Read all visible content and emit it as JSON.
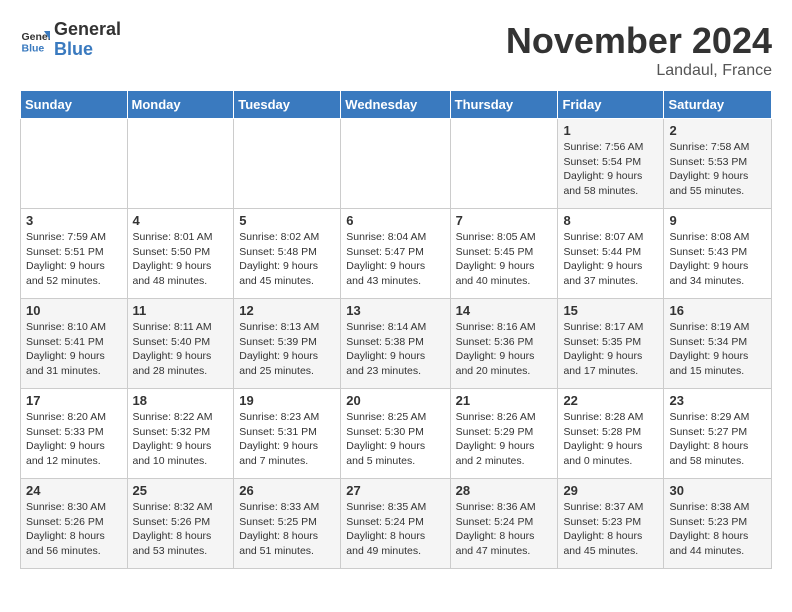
{
  "logo": {
    "line1": "General",
    "line2": "Blue"
  },
  "title": "November 2024",
  "location": "Landaul, France",
  "weekdays": [
    "Sunday",
    "Monday",
    "Tuesday",
    "Wednesday",
    "Thursday",
    "Friday",
    "Saturday"
  ],
  "weeks": [
    [
      {
        "day": "",
        "info": ""
      },
      {
        "day": "",
        "info": ""
      },
      {
        "day": "",
        "info": ""
      },
      {
        "day": "",
        "info": ""
      },
      {
        "day": "",
        "info": ""
      },
      {
        "day": "1",
        "info": "Sunrise: 7:56 AM\nSunset: 5:54 PM\nDaylight: 9 hours and 58 minutes."
      },
      {
        "day": "2",
        "info": "Sunrise: 7:58 AM\nSunset: 5:53 PM\nDaylight: 9 hours and 55 minutes."
      }
    ],
    [
      {
        "day": "3",
        "info": "Sunrise: 7:59 AM\nSunset: 5:51 PM\nDaylight: 9 hours and 52 minutes."
      },
      {
        "day": "4",
        "info": "Sunrise: 8:01 AM\nSunset: 5:50 PM\nDaylight: 9 hours and 48 minutes."
      },
      {
        "day": "5",
        "info": "Sunrise: 8:02 AM\nSunset: 5:48 PM\nDaylight: 9 hours and 45 minutes."
      },
      {
        "day": "6",
        "info": "Sunrise: 8:04 AM\nSunset: 5:47 PM\nDaylight: 9 hours and 43 minutes."
      },
      {
        "day": "7",
        "info": "Sunrise: 8:05 AM\nSunset: 5:45 PM\nDaylight: 9 hours and 40 minutes."
      },
      {
        "day": "8",
        "info": "Sunrise: 8:07 AM\nSunset: 5:44 PM\nDaylight: 9 hours and 37 minutes."
      },
      {
        "day": "9",
        "info": "Sunrise: 8:08 AM\nSunset: 5:43 PM\nDaylight: 9 hours and 34 minutes."
      }
    ],
    [
      {
        "day": "10",
        "info": "Sunrise: 8:10 AM\nSunset: 5:41 PM\nDaylight: 9 hours and 31 minutes."
      },
      {
        "day": "11",
        "info": "Sunrise: 8:11 AM\nSunset: 5:40 PM\nDaylight: 9 hours and 28 minutes."
      },
      {
        "day": "12",
        "info": "Sunrise: 8:13 AM\nSunset: 5:39 PM\nDaylight: 9 hours and 25 minutes."
      },
      {
        "day": "13",
        "info": "Sunrise: 8:14 AM\nSunset: 5:38 PM\nDaylight: 9 hours and 23 minutes."
      },
      {
        "day": "14",
        "info": "Sunrise: 8:16 AM\nSunset: 5:36 PM\nDaylight: 9 hours and 20 minutes."
      },
      {
        "day": "15",
        "info": "Sunrise: 8:17 AM\nSunset: 5:35 PM\nDaylight: 9 hours and 17 minutes."
      },
      {
        "day": "16",
        "info": "Sunrise: 8:19 AM\nSunset: 5:34 PM\nDaylight: 9 hours and 15 minutes."
      }
    ],
    [
      {
        "day": "17",
        "info": "Sunrise: 8:20 AM\nSunset: 5:33 PM\nDaylight: 9 hours and 12 minutes."
      },
      {
        "day": "18",
        "info": "Sunrise: 8:22 AM\nSunset: 5:32 PM\nDaylight: 9 hours and 10 minutes."
      },
      {
        "day": "19",
        "info": "Sunrise: 8:23 AM\nSunset: 5:31 PM\nDaylight: 9 hours and 7 minutes."
      },
      {
        "day": "20",
        "info": "Sunrise: 8:25 AM\nSunset: 5:30 PM\nDaylight: 9 hours and 5 minutes."
      },
      {
        "day": "21",
        "info": "Sunrise: 8:26 AM\nSunset: 5:29 PM\nDaylight: 9 hours and 2 minutes."
      },
      {
        "day": "22",
        "info": "Sunrise: 8:28 AM\nSunset: 5:28 PM\nDaylight: 9 hours and 0 minutes."
      },
      {
        "day": "23",
        "info": "Sunrise: 8:29 AM\nSunset: 5:27 PM\nDaylight: 8 hours and 58 minutes."
      }
    ],
    [
      {
        "day": "24",
        "info": "Sunrise: 8:30 AM\nSunset: 5:26 PM\nDaylight: 8 hours and 56 minutes."
      },
      {
        "day": "25",
        "info": "Sunrise: 8:32 AM\nSunset: 5:26 PM\nDaylight: 8 hours and 53 minutes."
      },
      {
        "day": "26",
        "info": "Sunrise: 8:33 AM\nSunset: 5:25 PM\nDaylight: 8 hours and 51 minutes."
      },
      {
        "day": "27",
        "info": "Sunrise: 8:35 AM\nSunset: 5:24 PM\nDaylight: 8 hours and 49 minutes."
      },
      {
        "day": "28",
        "info": "Sunrise: 8:36 AM\nSunset: 5:24 PM\nDaylight: 8 hours and 47 minutes."
      },
      {
        "day": "29",
        "info": "Sunrise: 8:37 AM\nSunset: 5:23 PM\nDaylight: 8 hours and 45 minutes."
      },
      {
        "day": "30",
        "info": "Sunrise: 8:38 AM\nSunset: 5:23 PM\nDaylight: 8 hours and 44 minutes."
      }
    ]
  ]
}
